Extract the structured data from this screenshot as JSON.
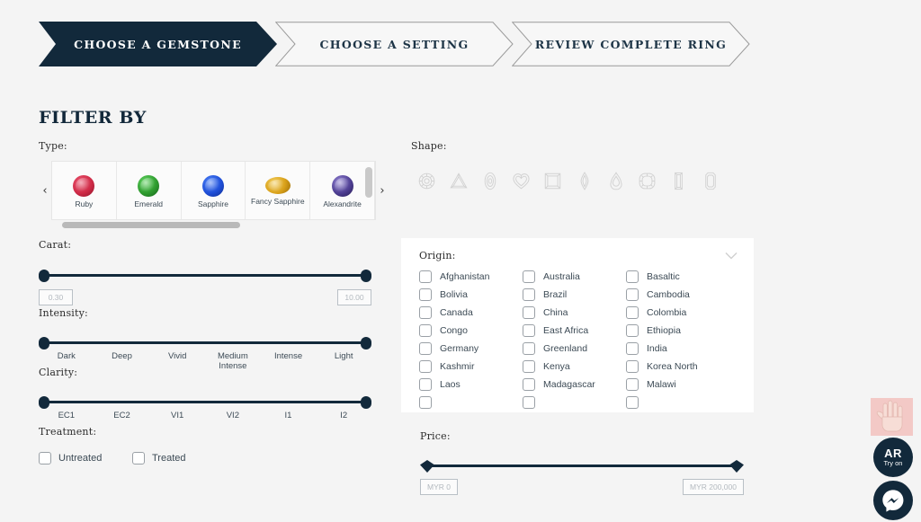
{
  "steps": [
    {
      "label": "CHOOSE A GEMSTONE",
      "state": "active"
    },
    {
      "label": "CHOOSE A SETTING",
      "state": "idle"
    },
    {
      "label": "REVIEW COMPLETE RING",
      "state": "idle"
    }
  ],
  "filter": {
    "title": "FILTER BY"
  },
  "type": {
    "label": "Type:",
    "prev_icon": "chevron-left-icon",
    "next_icon": "chevron-right-icon",
    "items": [
      {
        "name": "Ruby",
        "color": "#cf2b47",
        "shape": "round"
      },
      {
        "name": "Emerald",
        "color": "#2f9c2f",
        "shape": "round"
      },
      {
        "name": "Sapphire",
        "color": "#1f4fd8",
        "shape": "round"
      },
      {
        "name": "Fancy Sapphire",
        "color": "#d9a11a",
        "shape": "oval"
      },
      {
        "name": "Alexandrite",
        "color": "#5b4a9e",
        "shape": "round"
      }
    ]
  },
  "carat": {
    "label": "Carat:",
    "min_value": "0.30",
    "max_value": "10.00"
  },
  "intensity": {
    "label": "Intensity:",
    "ticks": [
      "Dark",
      "Deep",
      "Vivid",
      "Medium Intense",
      "Intense",
      "Light"
    ]
  },
  "clarity": {
    "label": "Clarity:",
    "ticks": [
      "EC1",
      "EC2",
      "VI1",
      "VI2",
      "I1",
      "I2"
    ]
  },
  "treatment": {
    "label": "Treatment:",
    "options": [
      {
        "label": "Untreated",
        "checked": false
      },
      {
        "label": "Treated",
        "checked": false
      }
    ]
  },
  "shape": {
    "label": "Shape:",
    "items": [
      "round-shape-icon",
      "trillion-shape-icon",
      "oval-shape-icon",
      "heart-shape-icon",
      "princess-shape-icon",
      "marquise-shape-icon",
      "pear-shape-icon",
      "cushion-shape-icon",
      "baguette-shape-icon",
      "emerald-shape-icon"
    ]
  },
  "origin": {
    "label": "Origin:",
    "collapse_icon": "chevron-down-icon",
    "items": [
      "Afghanistan",
      "Australia",
      "Basaltic",
      "Bolivia",
      "Brazil",
      "Cambodia",
      "Canada",
      "China",
      "Colombia",
      "Congo",
      "East Africa",
      "Ethiopia",
      "Germany",
      "Greenland",
      "India",
      "Kashmir",
      "Kenya",
      "Korea North",
      "Laos",
      "Madagascar",
      "Malawi"
    ]
  },
  "price": {
    "label": "Price:",
    "min_value": "MYR 0",
    "max_value": "MYR 200,000"
  },
  "widgets": {
    "hand_preview": "hand-preview-image",
    "ar": {
      "main": "AR",
      "sub": "Try on"
    },
    "messenger": "messenger-icon"
  },
  "colors": {
    "navy": "#12293b",
    "page_bg": "#f4f4f4",
    "panel": "#ffffff"
  }
}
